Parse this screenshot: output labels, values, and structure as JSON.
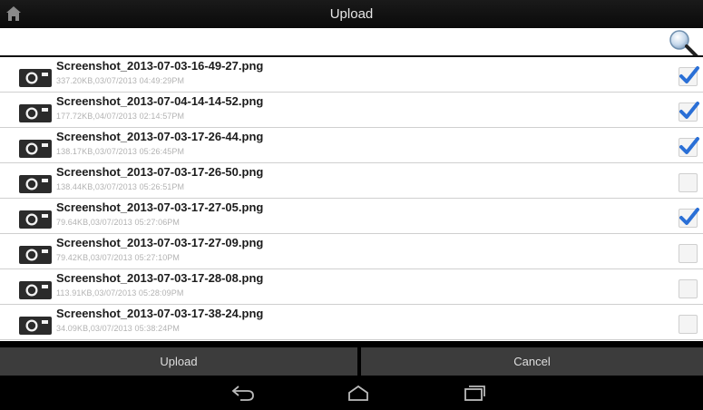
{
  "title": "Upload",
  "search": {
    "value": "",
    "placeholder": ""
  },
  "files": [
    {
      "name": "Screenshot_2013-07-03-16-49-27.png",
      "meta": "337.20KB,03/07/2013 04:49:29PM",
      "checked": true
    },
    {
      "name": "Screenshot_2013-07-04-14-14-52.png",
      "meta": "177.72KB,04/07/2013 02:14:57PM",
      "checked": true
    },
    {
      "name": "Screenshot_2013-07-03-17-26-44.png",
      "meta": "138.17KB,03/07/2013 05:26:45PM",
      "checked": true
    },
    {
      "name": "Screenshot_2013-07-03-17-26-50.png",
      "meta": "138.44KB,03/07/2013 05:26:51PM",
      "checked": false
    },
    {
      "name": "Screenshot_2013-07-03-17-27-05.png",
      "meta": "79.64KB,03/07/2013 05:27:06PM",
      "checked": true
    },
    {
      "name": "Screenshot_2013-07-03-17-27-09.png",
      "meta": "79.42KB,03/07/2013 05:27:10PM",
      "checked": false
    },
    {
      "name": "Screenshot_2013-07-03-17-28-08.png",
      "meta": "113.91KB,03/07/2013 05:28:09PM",
      "checked": false
    },
    {
      "name": "Screenshot_2013-07-03-17-38-24.png",
      "meta": "34.09KB,03/07/2013 05:38:24PM",
      "checked": false
    }
  ],
  "buttons": {
    "upload": "Upload",
    "cancel": "Cancel"
  },
  "icons": {
    "home": "home-icon",
    "search": "search-icon",
    "file": "camera-icon",
    "back": "back-icon",
    "home_nav": "home-nav-icon",
    "recents": "recent-apps-icon"
  },
  "colors": {
    "check": "#2a6fd6",
    "button": "#3c3c3c",
    "titlebar": "#111111"
  }
}
